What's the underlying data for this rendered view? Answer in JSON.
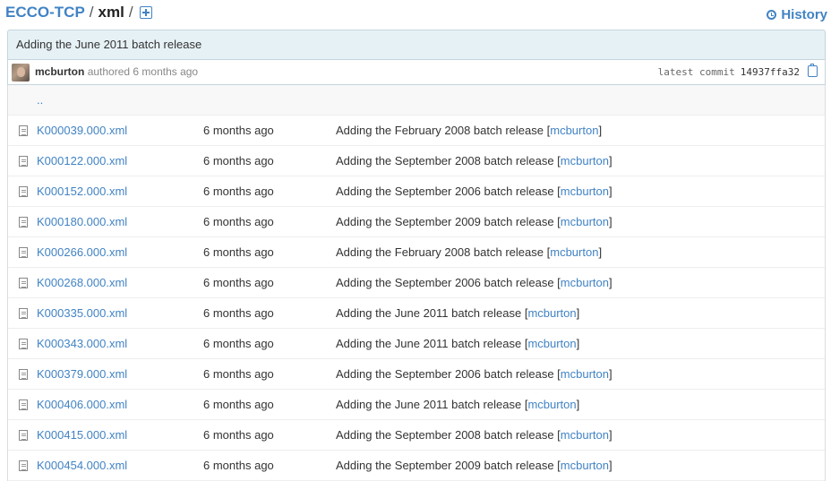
{
  "breadcrumb": {
    "root": "ECCO-TCP",
    "separator": "/",
    "current": "xml"
  },
  "history": {
    "label": "History"
  },
  "commit": {
    "message": "Adding the June 2011 batch release",
    "author": "mcburton",
    "authored_text": "authored 6 months ago",
    "latest_label": "latest commit",
    "sha": "14937ffa32"
  },
  "up_link": "..",
  "files": [
    {
      "name": "K000039.000.xml",
      "age": "6 months ago",
      "message": "Adding the February 2008 batch release",
      "author": "mcburton"
    },
    {
      "name": "K000122.000.xml",
      "age": "6 months ago",
      "message": "Adding the September 2008 batch release",
      "author": "mcburton"
    },
    {
      "name": "K000152.000.xml",
      "age": "6 months ago",
      "message": "Adding the September 2006 batch release",
      "author": "mcburton"
    },
    {
      "name": "K000180.000.xml",
      "age": "6 months ago",
      "message": "Adding the September 2009 batch release",
      "author": "mcburton"
    },
    {
      "name": "K000266.000.xml",
      "age": "6 months ago",
      "message": "Adding the February 2008 batch release",
      "author": "mcburton"
    },
    {
      "name": "K000268.000.xml",
      "age": "6 months ago",
      "message": "Adding the September 2006 batch release",
      "author": "mcburton"
    },
    {
      "name": "K000335.000.xml",
      "age": "6 months ago",
      "message": "Adding the June 2011 batch release",
      "author": "mcburton"
    },
    {
      "name": "K000343.000.xml",
      "age": "6 months ago",
      "message": "Adding the June 2011 batch release",
      "author": "mcburton"
    },
    {
      "name": "K000379.000.xml",
      "age": "6 months ago",
      "message": "Adding the September 2006 batch release",
      "author": "mcburton"
    },
    {
      "name": "K000406.000.xml",
      "age": "6 months ago",
      "message": "Adding the June 2011 batch release",
      "author": "mcburton"
    },
    {
      "name": "K000415.000.xml",
      "age": "6 months ago",
      "message": "Adding the September 2008 batch release",
      "author": "mcburton"
    },
    {
      "name": "K000454.000.xml",
      "age": "6 months ago",
      "message": "Adding the September 2009 batch release",
      "author": "mcburton"
    }
  ]
}
